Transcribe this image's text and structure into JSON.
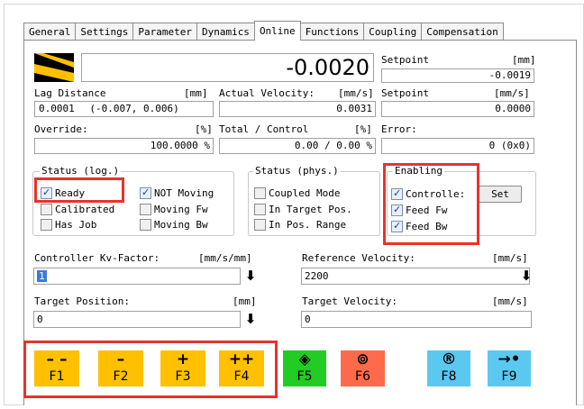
{
  "tabs": [
    {
      "label": "General"
    },
    {
      "label": "Settings"
    },
    {
      "label": "Parameter"
    },
    {
      "label": "Dynamics"
    },
    {
      "label": "Online"
    },
    {
      "label": "Functions"
    },
    {
      "label": "Coupling"
    },
    {
      "label": "Compensation"
    }
  ],
  "position": {
    "value": "-0.0020",
    "setpoint_label": "Setpoint",
    "setpoint_unit": "[mm]",
    "setpoint_value": "-0.0019"
  },
  "lag": {
    "label": "Lag Distance",
    "unit": "[mm]",
    "value": "0.0001",
    "range": "(-0.007, 0.006)"
  },
  "velocity": {
    "label": "Actual Velocity:",
    "unit": "[mm/s]",
    "value": "0.0031",
    "setpoint_label": "Setpoint",
    "setpoint_unit": "[mm/s]",
    "setpoint_value": "0.0000"
  },
  "override": {
    "label": "Override:",
    "unit": "[%]",
    "value": "100.0000 %"
  },
  "total": {
    "label": "Total / Control",
    "unit": "[%]",
    "value": "0.00 /  0.00 %"
  },
  "error": {
    "label": "Error:",
    "value": "0 (0x0)"
  },
  "status_log": {
    "title": "Status (log.)",
    "items": [
      {
        "label": "Ready",
        "checked": true
      },
      {
        "label": "Calibrated",
        "checked": false
      },
      {
        "label": "Has Job",
        "checked": false
      },
      {
        "label": "NOT Moving",
        "checked": true
      },
      {
        "label": "Moving Fw",
        "checked": false
      },
      {
        "label": "Moving Bw",
        "checked": false
      }
    ]
  },
  "status_phys": {
    "title": "Status (phys.)",
    "items": [
      {
        "label": "Coupled Mode",
        "checked": false
      },
      {
        "label": "In Target Pos.",
        "checked": false
      },
      {
        "label": "In Pos. Range",
        "checked": false
      }
    ]
  },
  "enabling": {
    "title": "Enabling",
    "set_label": "Set",
    "items": [
      {
        "label": "Controlle:",
        "checked": true
      },
      {
        "label": "Feed Fw",
        "checked": true
      },
      {
        "label": "Feed Bw",
        "checked": true
      }
    ]
  },
  "kv": {
    "label": "Controller Kv-Factor:",
    "unit": "[mm/s/mm]",
    "value": "1"
  },
  "ref_velocity": {
    "label": "Reference Velocity:",
    "unit": "[mm/s]",
    "value": "2200"
  },
  "target_position": {
    "label": "Target Position:",
    "unit": "[mm]",
    "value": "0"
  },
  "target_velocity": {
    "label": "Target Velocity:",
    "unit": "[mm/s]",
    "value": "0"
  },
  "fkeys": [
    {
      "symbol": "– –",
      "label": "F1",
      "icon": "double-minus-icon",
      "color": "#ffc000"
    },
    {
      "symbol": "–",
      "label": "F2",
      "icon": "minus-icon",
      "color": "#ffc000"
    },
    {
      "symbol": "+",
      "label": "F3",
      "icon": "plus-icon",
      "color": "#ffc000"
    },
    {
      "symbol": "++",
      "label": "F4",
      "icon": "double-plus-icon",
      "color": "#ffc000"
    },
    {
      "symbol": "◈",
      "label": "F5",
      "icon": "enable-diamond-icon",
      "color": "#22cc22"
    },
    {
      "symbol": "⊚",
      "label": "F6",
      "icon": "stop-icon",
      "color": "#ff6a4a"
    },
    {
      "symbol": "®",
      "label": "F8",
      "icon": "reset-r-icon",
      "color": "#5bc8ef"
    },
    {
      "symbol": "→•",
      "label": "F9",
      "icon": "move-to-target-icon",
      "color": "#5bc8ef"
    }
  ],
  "accent_colors": {
    "annotation_red": "#e8322c",
    "fkey_yellow": "#ffc000",
    "fkey_green": "#22cc22",
    "fkey_red": "#ff6a4a",
    "fkey_blue": "#5bc8ef"
  }
}
